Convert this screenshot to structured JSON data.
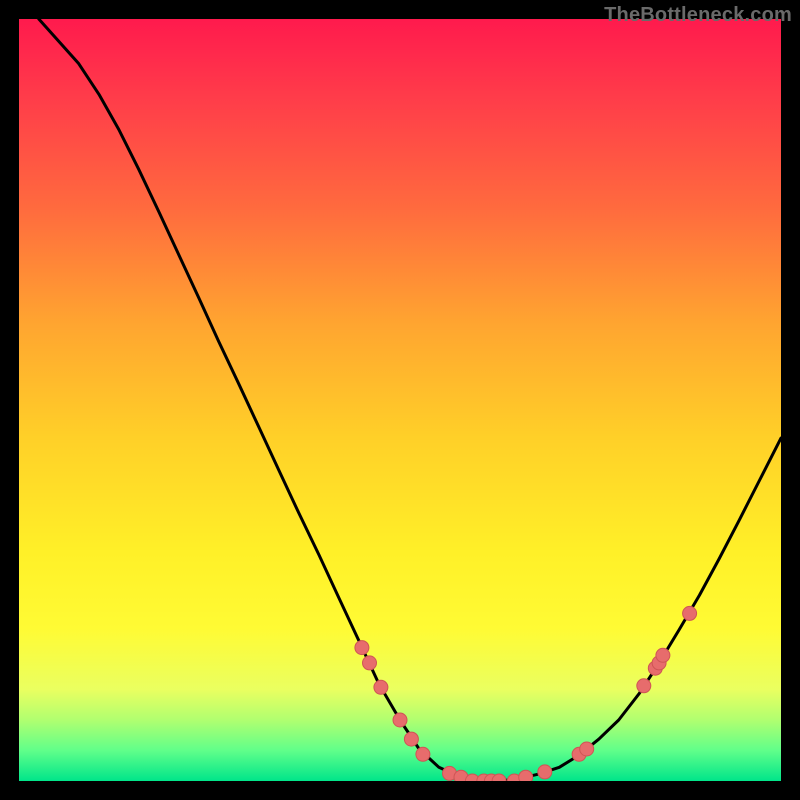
{
  "watermark": "TheBottleneck.com",
  "colors": {
    "curve": "#000000",
    "point_fill": "#e76c6c",
    "point_stroke": "#cf5555",
    "frame": "#000000"
  },
  "chart_data": {
    "type": "line",
    "title": "",
    "xlabel": "",
    "ylabel": "",
    "xlim": [
      0,
      100
    ],
    "ylim": [
      0,
      100
    ],
    "grid": false,
    "legend": false,
    "curve_points": [
      {
        "x": 2.6,
        "y": 100.0
      },
      {
        "x": 5.2,
        "y": 97.1
      },
      {
        "x": 7.8,
        "y": 94.2
      },
      {
        "x": 10.5,
        "y": 90.1
      },
      {
        "x": 13.1,
        "y": 85.5
      },
      {
        "x": 15.7,
        "y": 80.3
      },
      {
        "x": 18.4,
        "y": 74.6
      },
      {
        "x": 21.0,
        "y": 69.0
      },
      {
        "x": 23.6,
        "y": 63.4
      },
      {
        "x": 26.2,
        "y": 57.7
      },
      {
        "x": 28.9,
        "y": 52.0
      },
      {
        "x": 31.5,
        "y": 46.4
      },
      {
        "x": 34.1,
        "y": 40.8
      },
      {
        "x": 36.7,
        "y": 35.2
      },
      {
        "x": 39.4,
        "y": 29.6
      },
      {
        "x": 42.0,
        "y": 24.0
      },
      {
        "x": 44.6,
        "y": 18.4
      },
      {
        "x": 47.2,
        "y": 12.8
      },
      {
        "x": 50.0,
        "y": 8.0
      },
      {
        "x": 52.5,
        "y": 4.2
      },
      {
        "x": 55.1,
        "y": 1.8
      },
      {
        "x": 57.7,
        "y": 0.6
      },
      {
        "x": 60.4,
        "y": 0.0
      },
      {
        "x": 63.0,
        "y": 0.0
      },
      {
        "x": 65.6,
        "y": 0.3
      },
      {
        "x": 68.2,
        "y": 0.9
      },
      {
        "x": 70.9,
        "y": 1.8
      },
      {
        "x": 73.5,
        "y": 3.4
      },
      {
        "x": 76.1,
        "y": 5.5
      },
      {
        "x": 78.7,
        "y": 8.0
      },
      {
        "x": 81.4,
        "y": 11.5
      },
      {
        "x": 84.0,
        "y": 15.5
      },
      {
        "x": 86.6,
        "y": 19.8
      },
      {
        "x": 89.3,
        "y": 24.4
      },
      {
        "x": 91.9,
        "y": 29.2
      },
      {
        "x": 94.5,
        "y": 34.2
      },
      {
        "x": 97.1,
        "y": 39.3
      },
      {
        "x": 100.0,
        "y": 45.0
      }
    ],
    "scatter_points": [
      {
        "x": 45.0,
        "y": 17.5
      },
      {
        "x": 46.0,
        "y": 15.5
      },
      {
        "x": 47.5,
        "y": 12.3
      },
      {
        "x": 50.0,
        "y": 8.0
      },
      {
        "x": 51.5,
        "y": 5.5
      },
      {
        "x": 53.0,
        "y": 3.5
      },
      {
        "x": 56.5,
        "y": 1.0
      },
      {
        "x": 58.0,
        "y": 0.5
      },
      {
        "x": 59.5,
        "y": 0.0
      },
      {
        "x": 61.0,
        "y": 0.0
      },
      {
        "x": 62.0,
        "y": 0.0
      },
      {
        "x": 63.0,
        "y": 0.0
      },
      {
        "x": 65.0,
        "y": 0.0
      },
      {
        "x": 66.5,
        "y": 0.5
      },
      {
        "x": 69.0,
        "y": 1.2
      },
      {
        "x": 73.5,
        "y": 3.5
      },
      {
        "x": 74.5,
        "y": 4.2
      },
      {
        "x": 82.0,
        "y": 12.5
      },
      {
        "x": 83.5,
        "y": 14.8
      },
      {
        "x": 84.0,
        "y": 15.5
      },
      {
        "x": 84.5,
        "y": 16.5
      },
      {
        "x": 88.0,
        "y": 22.0
      }
    ]
  }
}
